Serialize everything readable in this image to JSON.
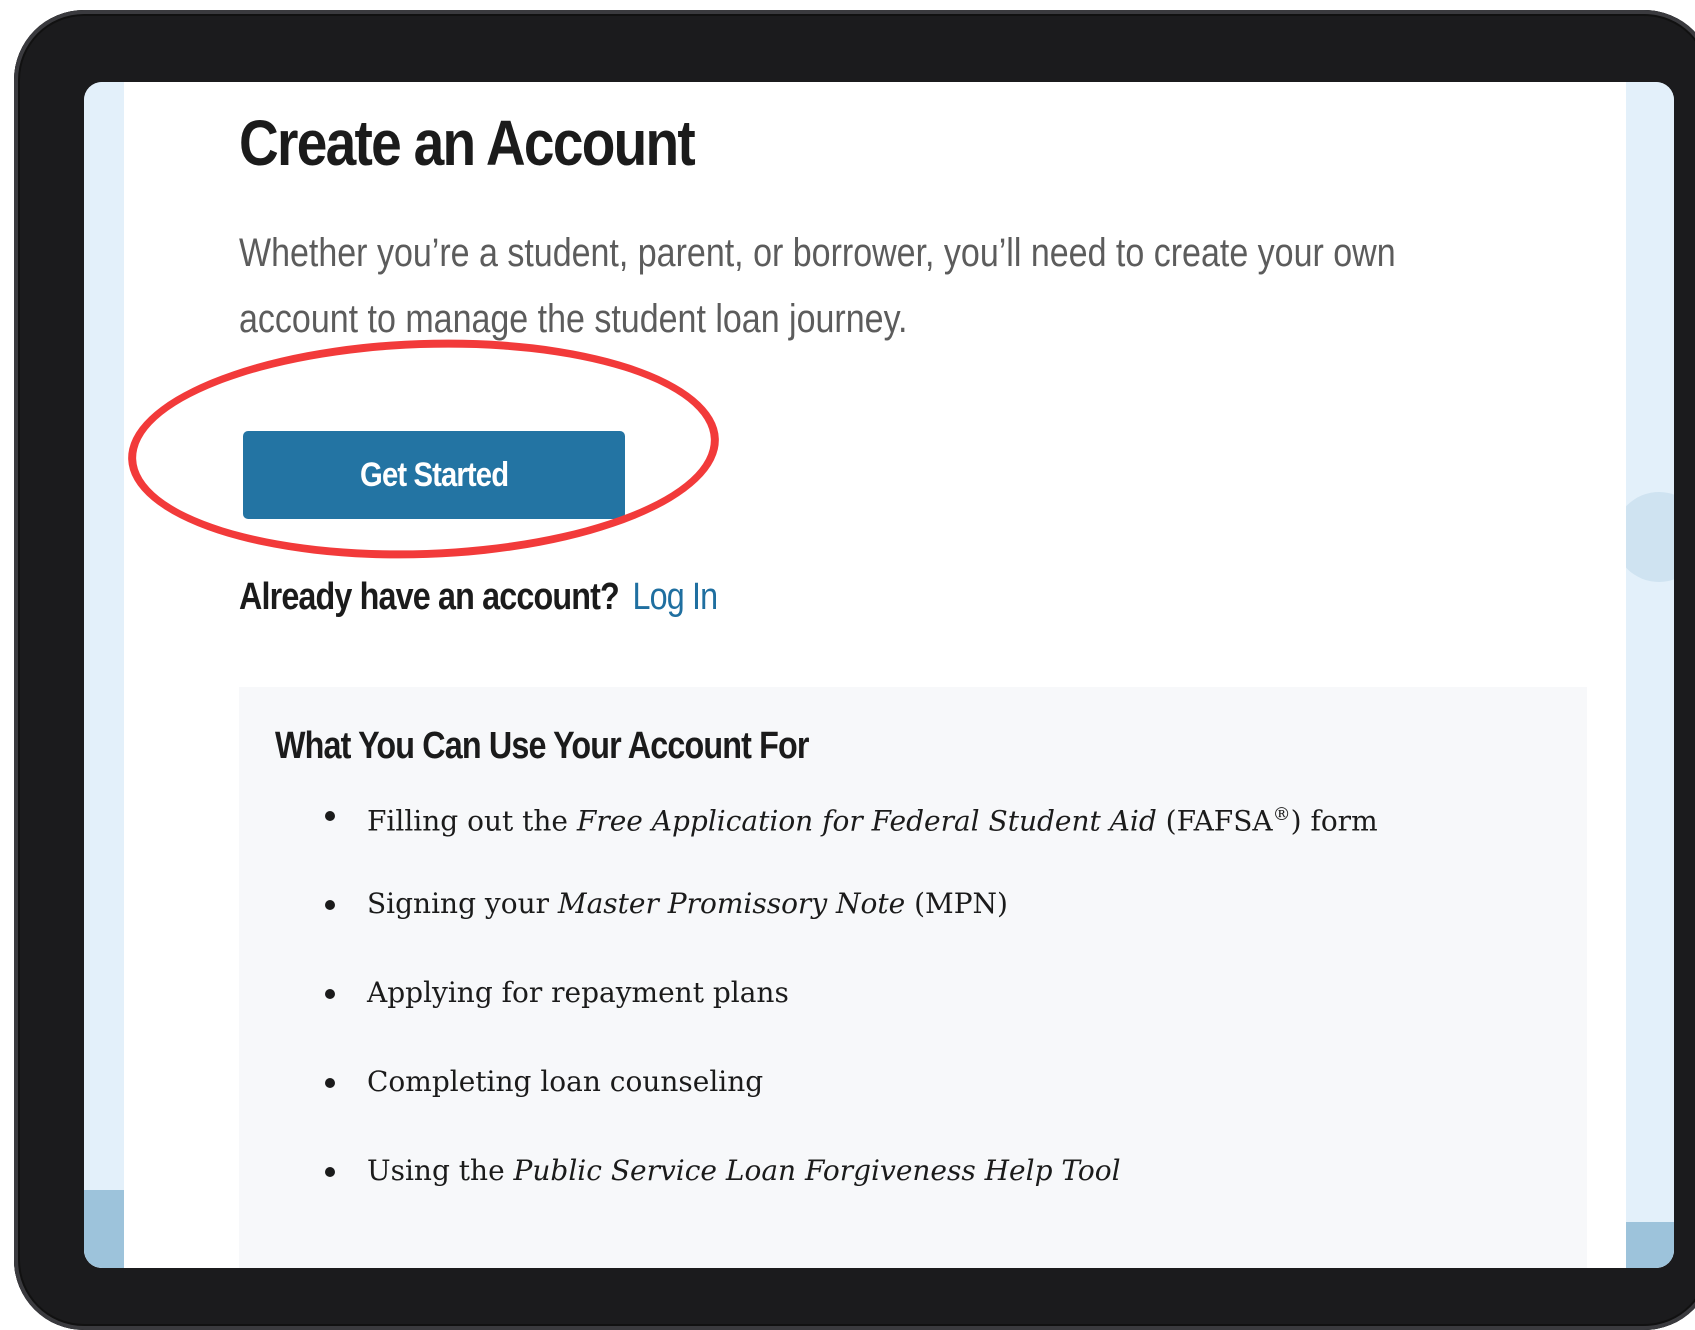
{
  "page": {
    "title": "Create an Account",
    "intro": "Whether you’re a student, parent, or borrower, you’ll need to create your own account to manage the student loan journey.",
    "primary_button": "Get Started",
    "login_prompt": "Already have an account?",
    "login_link": "Log In"
  },
  "uses": {
    "heading": "What You Can Use Your Account For",
    "items": [
      {
        "before": "Filling out the ",
        "emphasis": "Free Application for Federal Student Aid",
        "after": " (FAFSA",
        "superscript": "®",
        "tail": ") form"
      },
      {
        "before": "Signing your ",
        "emphasis": "Master Promissory Note",
        "after": " (MPN)"
      },
      {
        "before": "Applying for repayment plans"
      },
      {
        "before": "Completing loan counseling"
      },
      {
        "before": "Using the ",
        "emphasis": "Public Service Loan Forgiveness Help Tool"
      }
    ]
  },
  "colors": {
    "button": "#2374a3",
    "link": "#1f6fa0",
    "highlight": "#f23a3a",
    "card_background": "#f7f8fa"
  }
}
